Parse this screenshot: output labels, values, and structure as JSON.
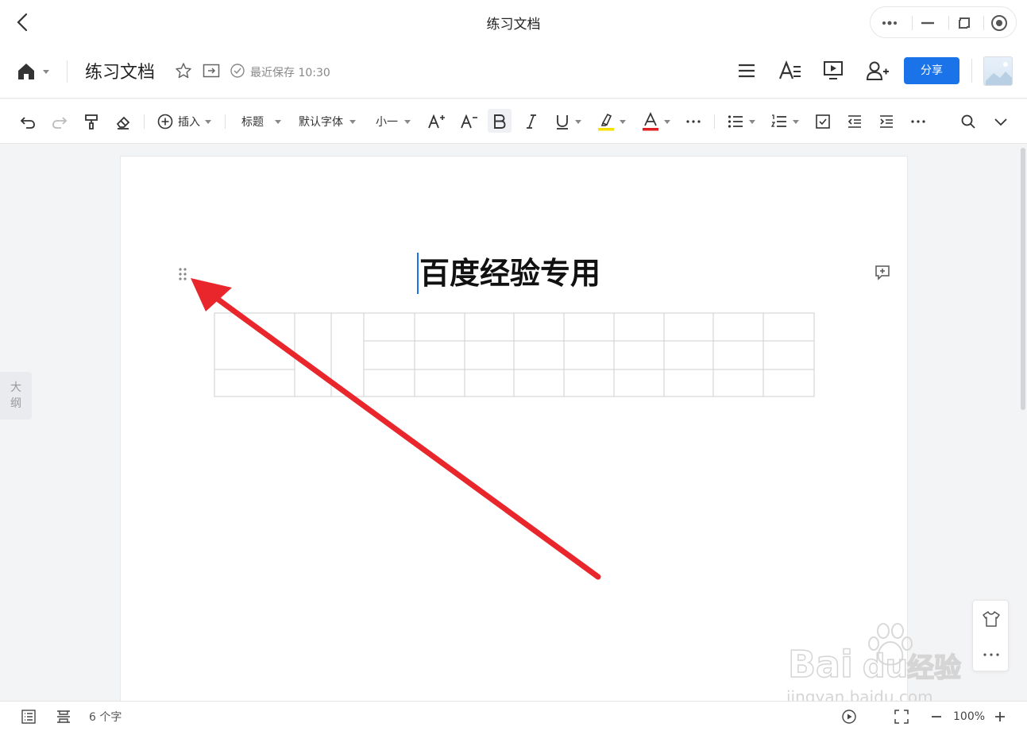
{
  "window": {
    "title": "练习文档"
  },
  "header": {
    "doc_title": "练习文档",
    "save_status": "最近保存 10:30",
    "share_label": "分享"
  },
  "toolbar": {
    "insert_label": "插入",
    "style_label": "标题",
    "font_label": "默认字体",
    "size_label": "小一",
    "highlight_color": "#f5e000",
    "font_color": "#e02020"
  },
  "document": {
    "heading": "百度经验专用",
    "table": {
      "columns": 12,
      "rows": 3,
      "note": ""
    }
  },
  "sidebar": {
    "outline_label_1": "大",
    "outline_label_2": "纲"
  },
  "statusbar": {
    "word_count": "6 个字",
    "zoom": "100%"
  },
  "theme": {
    "accent": "#1a73e8",
    "arrow": "#e8262c"
  },
  "watermark": {
    "brand": "Baidu 经验",
    "url": "jingyan.baidu.com"
  }
}
